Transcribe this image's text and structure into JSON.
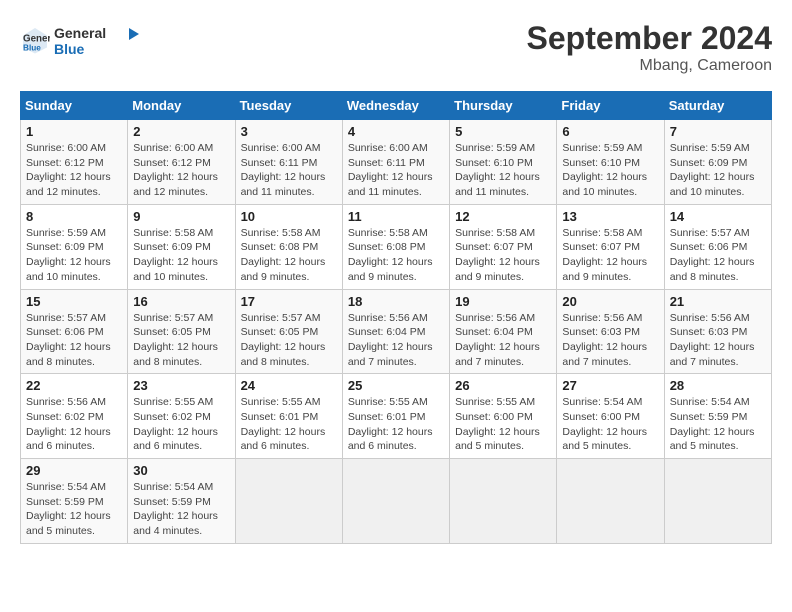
{
  "header": {
    "logo_line1": "General",
    "logo_line2": "Blue",
    "month_title": "September 2024",
    "location": "Mbang, Cameroon"
  },
  "calendar": {
    "days_of_week": [
      "Sunday",
      "Monday",
      "Tuesday",
      "Wednesday",
      "Thursday",
      "Friday",
      "Saturday"
    ],
    "weeks": [
      [
        {
          "num": "",
          "info": ""
        },
        {
          "num": "",
          "info": ""
        },
        {
          "num": "",
          "info": ""
        },
        {
          "num": "",
          "info": ""
        },
        {
          "num": "",
          "info": ""
        },
        {
          "num": "",
          "info": ""
        },
        {
          "num": "",
          "info": ""
        }
      ]
    ],
    "rows": [
      [
        {
          "day": "1",
          "sunrise": "Sunrise: 6:00 AM",
          "sunset": "Sunset: 6:12 PM",
          "daylight": "Daylight: 12 hours and 12 minutes."
        },
        {
          "day": "2",
          "sunrise": "Sunrise: 6:00 AM",
          "sunset": "Sunset: 6:12 PM",
          "daylight": "Daylight: 12 hours and 12 minutes."
        },
        {
          "day": "3",
          "sunrise": "Sunrise: 6:00 AM",
          "sunset": "Sunset: 6:11 PM",
          "daylight": "Daylight: 12 hours and 11 minutes."
        },
        {
          "day": "4",
          "sunrise": "Sunrise: 6:00 AM",
          "sunset": "Sunset: 6:11 PM",
          "daylight": "Daylight: 12 hours and 11 minutes."
        },
        {
          "day": "5",
          "sunrise": "Sunrise: 5:59 AM",
          "sunset": "Sunset: 6:10 PM",
          "daylight": "Daylight: 12 hours and 11 minutes."
        },
        {
          "day": "6",
          "sunrise": "Sunrise: 5:59 AM",
          "sunset": "Sunset: 6:10 PM",
          "daylight": "Daylight: 12 hours and 10 minutes."
        },
        {
          "day": "7",
          "sunrise": "Sunrise: 5:59 AM",
          "sunset": "Sunset: 6:09 PM",
          "daylight": "Daylight: 12 hours and 10 minutes."
        }
      ],
      [
        {
          "day": "8",
          "sunrise": "Sunrise: 5:59 AM",
          "sunset": "Sunset: 6:09 PM",
          "daylight": "Daylight: 12 hours and 10 minutes."
        },
        {
          "day": "9",
          "sunrise": "Sunrise: 5:58 AM",
          "sunset": "Sunset: 6:09 PM",
          "daylight": "Daylight: 12 hours and 10 minutes."
        },
        {
          "day": "10",
          "sunrise": "Sunrise: 5:58 AM",
          "sunset": "Sunset: 6:08 PM",
          "daylight": "Daylight: 12 hours and 9 minutes."
        },
        {
          "day": "11",
          "sunrise": "Sunrise: 5:58 AM",
          "sunset": "Sunset: 6:08 PM",
          "daylight": "Daylight: 12 hours and 9 minutes."
        },
        {
          "day": "12",
          "sunrise": "Sunrise: 5:58 AM",
          "sunset": "Sunset: 6:07 PM",
          "daylight": "Daylight: 12 hours and 9 minutes."
        },
        {
          "day": "13",
          "sunrise": "Sunrise: 5:58 AM",
          "sunset": "Sunset: 6:07 PM",
          "daylight": "Daylight: 12 hours and 9 minutes."
        },
        {
          "day": "14",
          "sunrise": "Sunrise: 5:57 AM",
          "sunset": "Sunset: 6:06 PM",
          "daylight": "Daylight: 12 hours and 8 minutes."
        }
      ],
      [
        {
          "day": "15",
          "sunrise": "Sunrise: 5:57 AM",
          "sunset": "Sunset: 6:06 PM",
          "daylight": "Daylight: 12 hours and 8 minutes."
        },
        {
          "day": "16",
          "sunrise": "Sunrise: 5:57 AM",
          "sunset": "Sunset: 6:05 PM",
          "daylight": "Daylight: 12 hours and 8 minutes."
        },
        {
          "day": "17",
          "sunrise": "Sunrise: 5:57 AM",
          "sunset": "Sunset: 6:05 PM",
          "daylight": "Daylight: 12 hours and 8 minutes."
        },
        {
          "day": "18",
          "sunrise": "Sunrise: 5:56 AM",
          "sunset": "Sunset: 6:04 PM",
          "daylight": "Daylight: 12 hours and 7 minutes."
        },
        {
          "day": "19",
          "sunrise": "Sunrise: 5:56 AM",
          "sunset": "Sunset: 6:04 PM",
          "daylight": "Daylight: 12 hours and 7 minutes."
        },
        {
          "day": "20",
          "sunrise": "Sunrise: 5:56 AM",
          "sunset": "Sunset: 6:03 PM",
          "daylight": "Daylight: 12 hours and 7 minutes."
        },
        {
          "day": "21",
          "sunrise": "Sunrise: 5:56 AM",
          "sunset": "Sunset: 6:03 PM",
          "daylight": "Daylight: 12 hours and 7 minutes."
        }
      ],
      [
        {
          "day": "22",
          "sunrise": "Sunrise: 5:56 AM",
          "sunset": "Sunset: 6:02 PM",
          "daylight": "Daylight: 12 hours and 6 minutes."
        },
        {
          "day": "23",
          "sunrise": "Sunrise: 5:55 AM",
          "sunset": "Sunset: 6:02 PM",
          "daylight": "Daylight: 12 hours and 6 minutes."
        },
        {
          "day": "24",
          "sunrise": "Sunrise: 5:55 AM",
          "sunset": "Sunset: 6:01 PM",
          "daylight": "Daylight: 12 hours and 6 minutes."
        },
        {
          "day": "25",
          "sunrise": "Sunrise: 5:55 AM",
          "sunset": "Sunset: 6:01 PM",
          "daylight": "Daylight: 12 hours and 6 minutes."
        },
        {
          "day": "26",
          "sunrise": "Sunrise: 5:55 AM",
          "sunset": "Sunset: 6:00 PM",
          "daylight": "Daylight: 12 hours and 5 minutes."
        },
        {
          "day": "27",
          "sunrise": "Sunrise: 5:54 AM",
          "sunset": "Sunset: 6:00 PM",
          "daylight": "Daylight: 12 hours and 5 minutes."
        },
        {
          "day": "28",
          "sunrise": "Sunrise: 5:54 AM",
          "sunset": "Sunset: 5:59 PM",
          "daylight": "Daylight: 12 hours and 5 minutes."
        }
      ],
      [
        {
          "day": "29",
          "sunrise": "Sunrise: 5:54 AM",
          "sunset": "Sunset: 5:59 PM",
          "daylight": "Daylight: 12 hours and 5 minutes."
        },
        {
          "day": "30",
          "sunrise": "Sunrise: 5:54 AM",
          "sunset": "Sunset: 5:59 PM",
          "daylight": "Daylight: 12 hours and 4 minutes."
        },
        {
          "day": "",
          "sunrise": "",
          "sunset": "",
          "daylight": ""
        },
        {
          "day": "",
          "sunrise": "",
          "sunset": "",
          "daylight": ""
        },
        {
          "day": "",
          "sunrise": "",
          "sunset": "",
          "daylight": ""
        },
        {
          "day": "",
          "sunrise": "",
          "sunset": "",
          "daylight": ""
        },
        {
          "day": "",
          "sunrise": "",
          "sunset": "",
          "daylight": ""
        }
      ]
    ]
  }
}
